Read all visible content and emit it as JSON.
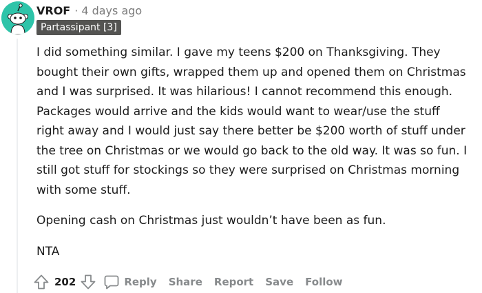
{
  "comment": {
    "avatar_icon": "snoo-avatar-icon",
    "avatar_color": "#2ec4a9",
    "username": "VROF",
    "separator": "·",
    "time_ago": "4 days ago",
    "flair": "Partassipant [3]",
    "flair_color": "#545452",
    "paragraphs": [
      {
        "lines": [
          "I did something similar. I gave my teens $200 on Thanksgiving. They",
          "bought their own gifts, wrapped them up and opened them on Christmas",
          "and I was surprised. It was hilarious! I cannot recommend this enough.",
          "Packages would arrive and the kids would want to wear/use the stuff",
          "right away and I would just say there better be $200 worth of stuff under",
          "the tree on Christmas or we would go back to the old way. It was so fun. I",
          "still got stuff for stockings so they were surprised on Christmas morning",
          "with some stuff."
        ]
      },
      {
        "lines": [
          "Opening cash on Christmas just wouldn’t have been as fun."
        ]
      },
      {
        "lines": [
          "NTA"
        ]
      }
    ]
  },
  "actions": {
    "upvote_icon": "upvote-arrow-icon",
    "score": "202",
    "downvote_icon": "downvote-arrow-icon",
    "reply_icon": "comment-bubble-icon",
    "reply_label": "Reply",
    "share_label": "Share",
    "report_label": "Report",
    "save_label": "Save",
    "follow_label": "Follow"
  }
}
